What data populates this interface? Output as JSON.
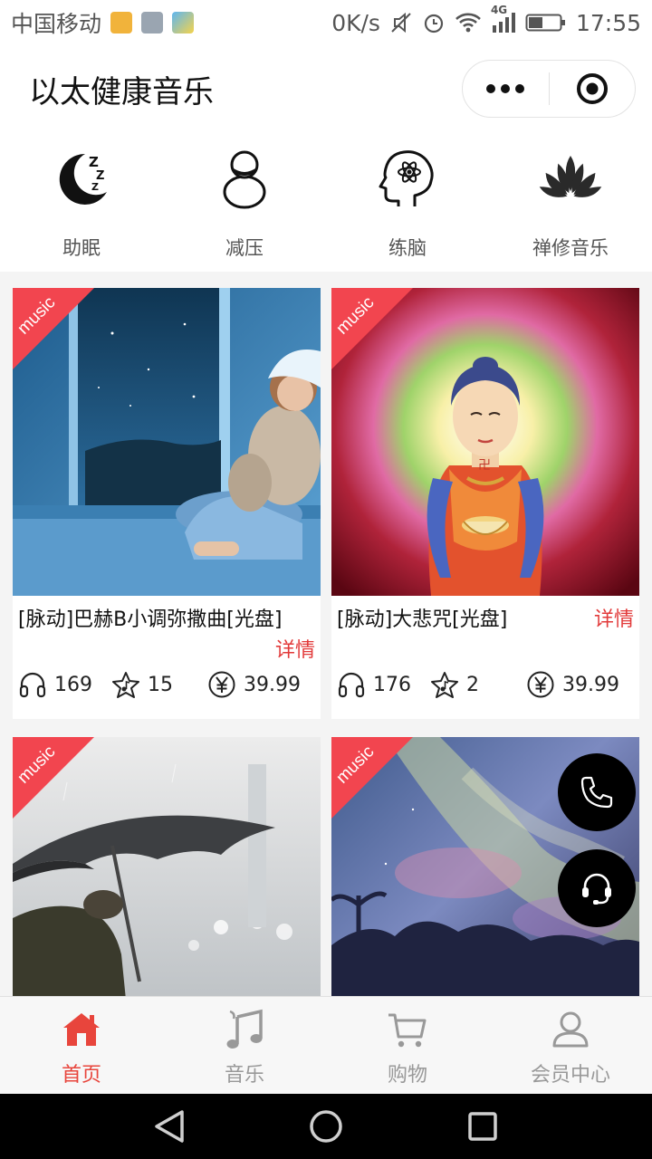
{
  "status_bar": {
    "carrier": "中国移动",
    "net_speed": "0K/s",
    "network": "4G",
    "time": "17:55"
  },
  "header": {
    "title": "以太健康音乐"
  },
  "categories": [
    {
      "label": "助眠",
      "icon": "moon-sleep-icon"
    },
    {
      "label": "减压",
      "icon": "duck-icon"
    },
    {
      "label": "练脑",
      "icon": "brain-head-icon"
    },
    {
      "label": "禅修音乐",
      "icon": "lotus-icon"
    }
  ],
  "products": [
    {
      "tag": "music",
      "name": "[脉动]巴赫B小调弥撒曲[光盘]",
      "detail": "详情",
      "plays": "169",
      "favorites": "15",
      "price": "39.99"
    },
    {
      "tag": "music",
      "name": "[脉动]大悲咒[光盘]",
      "detail": "详情",
      "plays": "176",
      "favorites": "2",
      "price": "39.99"
    },
    {
      "tag": "music"
    },
    {
      "tag": "music"
    }
  ],
  "tabs": [
    {
      "label": "首页",
      "icon": "home-icon",
      "active": true
    },
    {
      "label": "音乐",
      "icon": "music-note-icon"
    },
    {
      "label": "购物",
      "icon": "cart-icon"
    },
    {
      "label": "会员中心",
      "icon": "user-icon"
    }
  ],
  "colors": {
    "accent": "#e8453c",
    "ribbon": "#f2454f",
    "detail_link": "#e23a3a",
    "tab_inactive": "#999999"
  }
}
